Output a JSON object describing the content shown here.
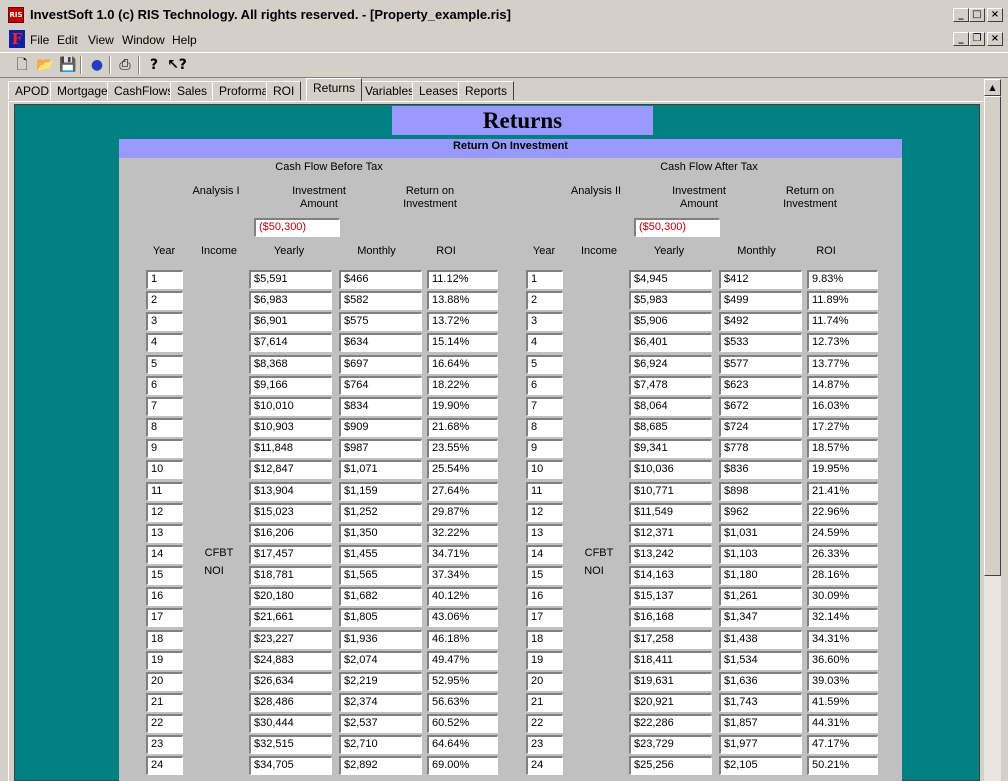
{
  "window": {
    "title": "InvestSoft 1.0 (c) RIS Technology. All rights reserved. - [Property_example.ris]",
    "app_icon_label": "RIS",
    "mdi_icon_label": "F"
  },
  "menu": [
    {
      "label": "File"
    },
    {
      "label": "Edit"
    },
    {
      "label": "View"
    },
    {
      "label": "Window"
    },
    {
      "label": "Help"
    }
  ],
  "toolbar": [
    "new-icon",
    "open-icon",
    "save-icon",
    "chart-icon",
    "print-icon",
    "help-icon",
    "context-help-icon"
  ],
  "tabs": [
    {
      "label": "APOD"
    },
    {
      "label": "Mortgage"
    },
    {
      "label": "CashFlows"
    },
    {
      "label": "Sales"
    },
    {
      "label": "Proforma"
    },
    {
      "label": "ROI"
    },
    {
      "label": "Returns",
      "active": true
    },
    {
      "label": "Variables"
    },
    {
      "label": "Leases"
    },
    {
      "label": "Reports"
    }
  ],
  "page": {
    "title": "Returns",
    "subtitle": "Return On Investment"
  },
  "left": {
    "group_title": "Cash Flow Before Tax",
    "analysis_label": "Analysis I",
    "investment_label_1": "Investment",
    "investment_label_2": "Amount",
    "roi_label_1": "Return on",
    "roi_label_2": "Investment",
    "investment_value": "($50,300)",
    "col_year": "Year",
    "col_income": "Income",
    "col_yearly": "Yearly",
    "col_monthly": "Monthly",
    "col_roi": "ROI",
    "income_opt1": "CFBT",
    "income_opt2": "NOI",
    "rows": [
      {
        "year": "1",
        "yearly": "$5,591",
        "monthly": "$466",
        "roi": "11.12%"
      },
      {
        "year": "2",
        "yearly": "$6,983",
        "monthly": "$582",
        "roi": "13.88%"
      },
      {
        "year": "3",
        "yearly": "$6,901",
        "monthly": "$575",
        "roi": "13.72%"
      },
      {
        "year": "4",
        "yearly": "$7,614",
        "monthly": "$634",
        "roi": "15.14%"
      },
      {
        "year": "5",
        "yearly": "$8,368",
        "monthly": "$697",
        "roi": "16.64%"
      },
      {
        "year": "6",
        "yearly": "$9,166",
        "monthly": "$764",
        "roi": "18.22%"
      },
      {
        "year": "7",
        "yearly": "$10,010",
        "monthly": "$834",
        "roi": "19.90%"
      },
      {
        "year": "8",
        "yearly": "$10,903",
        "monthly": "$909",
        "roi": "21.68%"
      },
      {
        "year": "9",
        "yearly": "$11,848",
        "monthly": "$987",
        "roi": "23.55%"
      },
      {
        "year": "10",
        "yearly": "$12,847",
        "monthly": "$1,071",
        "roi": "25.54%"
      },
      {
        "year": "11",
        "yearly": "$13,904",
        "monthly": "$1,159",
        "roi": "27.64%"
      },
      {
        "year": "12",
        "yearly": "$15,023",
        "monthly": "$1,252",
        "roi": "29.87%"
      },
      {
        "year": "13",
        "yearly": "$16,206",
        "monthly": "$1,350",
        "roi": "32.22%"
      },
      {
        "year": "14",
        "yearly": "$17,457",
        "monthly": "$1,455",
        "roi": "34.71%"
      },
      {
        "year": "15",
        "yearly": "$18,781",
        "monthly": "$1,565",
        "roi": "37.34%"
      },
      {
        "year": "16",
        "yearly": "$20,180",
        "monthly": "$1,682",
        "roi": "40.12%"
      },
      {
        "year": "17",
        "yearly": "$21,661",
        "monthly": "$1,805",
        "roi": "43.06%"
      },
      {
        "year": "18",
        "yearly": "$23,227",
        "monthly": "$1,936",
        "roi": "46.18%"
      },
      {
        "year": "19",
        "yearly": "$24,883",
        "monthly": "$2,074",
        "roi": "49.47%"
      },
      {
        "year": "20",
        "yearly": "$26,634",
        "monthly": "$2,219",
        "roi": "52.95%"
      },
      {
        "year": "21",
        "yearly": "$28,486",
        "monthly": "$2,374",
        "roi": "56.63%"
      },
      {
        "year": "22",
        "yearly": "$30,444",
        "monthly": "$2,537",
        "roi": "60.52%"
      },
      {
        "year": "23",
        "yearly": "$32,515",
        "monthly": "$2,710",
        "roi": "64.64%"
      },
      {
        "year": "24",
        "yearly": "$34,705",
        "monthly": "$2,892",
        "roi": "69.00%"
      }
    ]
  },
  "right": {
    "group_title": "Cash Flow After Tax",
    "analysis_label": "Analysis II",
    "investment_label_1": "Investment",
    "investment_label_2": "Amount",
    "roi_label_1": "Return on",
    "roi_label_2": "Investment",
    "investment_value": "($50,300)",
    "col_year": "Year",
    "col_income": "Income",
    "col_yearly": "Yearly",
    "col_monthly": "Monthly",
    "col_roi": "ROI",
    "income_opt1": "CFBT",
    "income_opt2": "NOI",
    "rows": [
      {
        "year": "1",
        "yearly": "$4,945",
        "monthly": "$412",
        "roi": "9.83%"
      },
      {
        "year": "2",
        "yearly": "$5,983",
        "monthly": "$499",
        "roi": "11.89%"
      },
      {
        "year": "3",
        "yearly": "$5,906",
        "monthly": "$492",
        "roi": "11.74%"
      },
      {
        "year": "4",
        "yearly": "$6,401",
        "monthly": "$533",
        "roi": "12.73%"
      },
      {
        "year": "5",
        "yearly": "$6,924",
        "monthly": "$577",
        "roi": "13.77%"
      },
      {
        "year": "6",
        "yearly": "$7,478",
        "monthly": "$623",
        "roi": "14.87%"
      },
      {
        "year": "7",
        "yearly": "$8,064",
        "monthly": "$672",
        "roi": "16.03%"
      },
      {
        "year": "8",
        "yearly": "$8,685",
        "monthly": "$724",
        "roi": "17.27%"
      },
      {
        "year": "9",
        "yearly": "$9,341",
        "monthly": "$778",
        "roi": "18.57%"
      },
      {
        "year": "10",
        "yearly": "$10,036",
        "monthly": "$836",
        "roi": "19.95%"
      },
      {
        "year": "11",
        "yearly": "$10,771",
        "monthly": "$898",
        "roi": "21.41%"
      },
      {
        "year": "12",
        "yearly": "$11,549",
        "monthly": "$962",
        "roi": "22.96%"
      },
      {
        "year": "13",
        "yearly": "$12,371",
        "monthly": "$1,031",
        "roi": "24.59%"
      },
      {
        "year": "14",
        "yearly": "$13,242",
        "monthly": "$1,103",
        "roi": "26.33%"
      },
      {
        "year": "15",
        "yearly": "$14,163",
        "monthly": "$1,180",
        "roi": "28.16%"
      },
      {
        "year": "16",
        "yearly": "$15,137",
        "monthly": "$1,261",
        "roi": "30.09%"
      },
      {
        "year": "17",
        "yearly": "$16,168",
        "monthly": "$1,347",
        "roi": "32.14%"
      },
      {
        "year": "18",
        "yearly": "$17,258",
        "monthly": "$1,438",
        "roi": "34.31%"
      },
      {
        "year": "19",
        "yearly": "$18,411",
        "monthly": "$1,534",
        "roi": "36.60%"
      },
      {
        "year": "20",
        "yearly": "$19,631",
        "monthly": "$1,636",
        "roi": "39.03%"
      },
      {
        "year": "21",
        "yearly": "$20,921",
        "monthly": "$1,743",
        "roi": "41.59%"
      },
      {
        "year": "22",
        "yearly": "$22,286",
        "monthly": "$1,857",
        "roi": "44.31%"
      },
      {
        "year": "23",
        "yearly": "$23,729",
        "monthly": "$1,977",
        "roi": "47.17%"
      },
      {
        "year": "24",
        "yearly": "$25,256",
        "monthly": "$2,105",
        "roi": "50.21%"
      }
    ]
  },
  "colors": {
    "panel_bg": "#008080",
    "banner_bg": "#9999ff",
    "negative_text": "#c00000"
  }
}
